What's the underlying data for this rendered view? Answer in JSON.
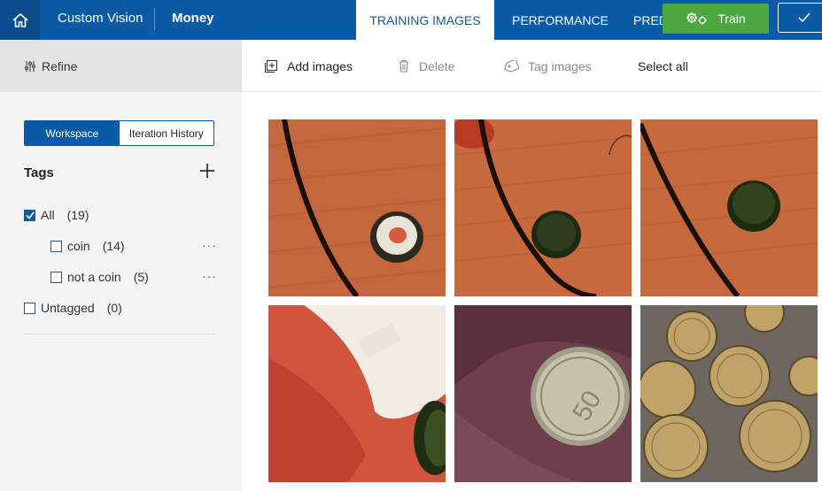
{
  "header": {
    "brand": "Custom Vision",
    "project": "Money",
    "tabs": [
      {
        "label": "TRAINING IMAGES",
        "active": true
      },
      {
        "label": "PERFORMANCE",
        "active": false
      },
      {
        "label": "PRED",
        "active": false
      }
    ],
    "train_label": "Train",
    "home_icon": "home-icon",
    "quick_test_icon": "checkmark-icon"
  },
  "sidebar": {
    "refine_label": "Refine",
    "segment": {
      "workspace": "Workspace",
      "iteration_history": "Iteration History"
    },
    "tags_title": "Tags",
    "tags": [
      {
        "label": "All",
        "count": "(19)",
        "checked": true
      },
      {
        "label": "coin",
        "count": "(14)",
        "checked": false
      },
      {
        "label": "not a coin",
        "count": "(5)",
        "checked": false
      },
      {
        "label": "Untagged",
        "count": "(0)",
        "checked": false
      }
    ]
  },
  "toolbar": {
    "add_images": "Add images",
    "delete": "Delete",
    "tag_images": "Tag images",
    "select_all": "Select all"
  },
  "images": [
    {
      "subject": "bottle cap with red label on wooden table"
    },
    {
      "subject": "green bottle cap on wooden table"
    },
    {
      "subject": "green bottle cap on wooden table"
    },
    {
      "subject": "hand holding bottle cap"
    },
    {
      "subject": "hand holding 50 cent euro coin"
    },
    {
      "subject": "pile of euro cent coins"
    }
  ],
  "colors": {
    "header_bg": "#0a5aa6",
    "home_bg": "#0a4c8c",
    "train_green": "#4ca741",
    "sidebar_bg": "#f4f4f4",
    "wood": "#c0653a"
  }
}
